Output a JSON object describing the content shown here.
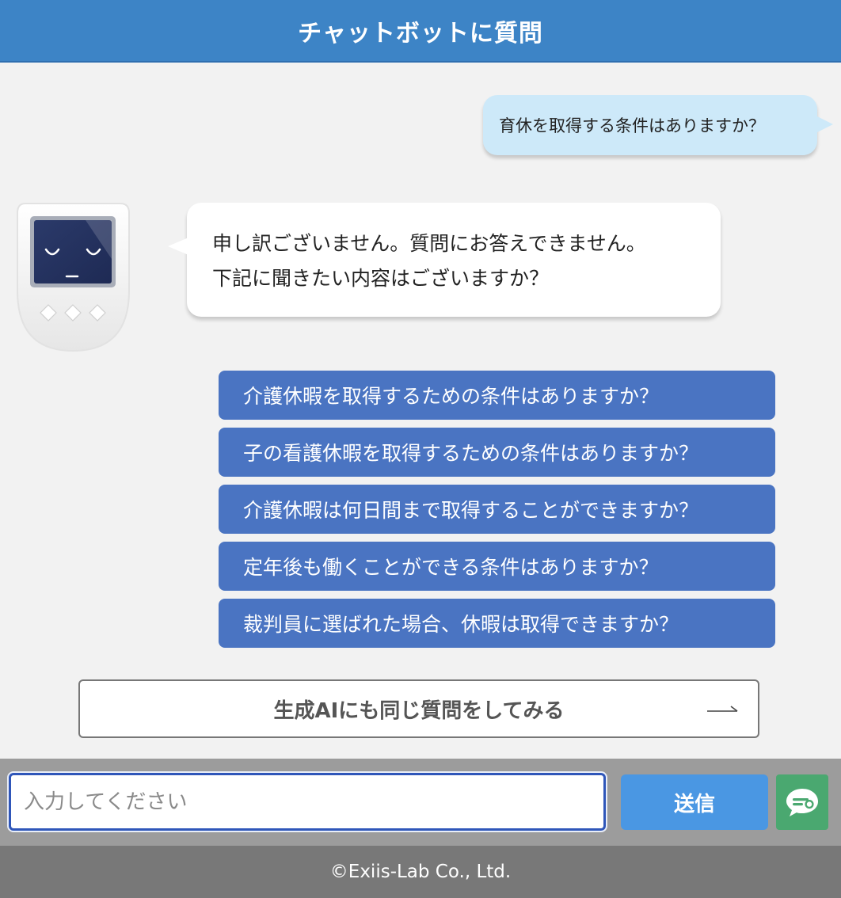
{
  "header": {
    "title": "チャットボットに質問"
  },
  "conversation": {
    "user_message": "育休を取得する条件はありますか？",
    "bot_message_lines": [
      "申し訳ございません。質問にお答えできません。",
      "下記に聞きたい内容はございますか？"
    ],
    "suggestions": [
      "介護休暇を取得するための条件はありますか？",
      "子の看護休暇を取得するための条件はありますか？",
      "介護休暇は何日間まで取得することができますか？",
      "定年後も働くことができる条件はありますか？",
      "裁判員に選ばれた場合、休暇は取得できますか？"
    ]
  },
  "generative_ai_button": {
    "label": "生成AIにも同じ質問をしてみる",
    "icon": "arrow-right-icon"
  },
  "input_bar": {
    "placeholder": "入力してください",
    "value": "",
    "send_label": "送信",
    "toggle_icon": "chat-bubble-icon"
  },
  "footer": {
    "copyright": "©Exiis-Lab Co., Ltd."
  },
  "colors": {
    "header": "#3d84c6",
    "user_bubble": "#cde9f9",
    "suggestion": "#4a74c2",
    "send_button": "#4a97e3",
    "toggle_button": "#4aa870",
    "footer": "#787878"
  }
}
